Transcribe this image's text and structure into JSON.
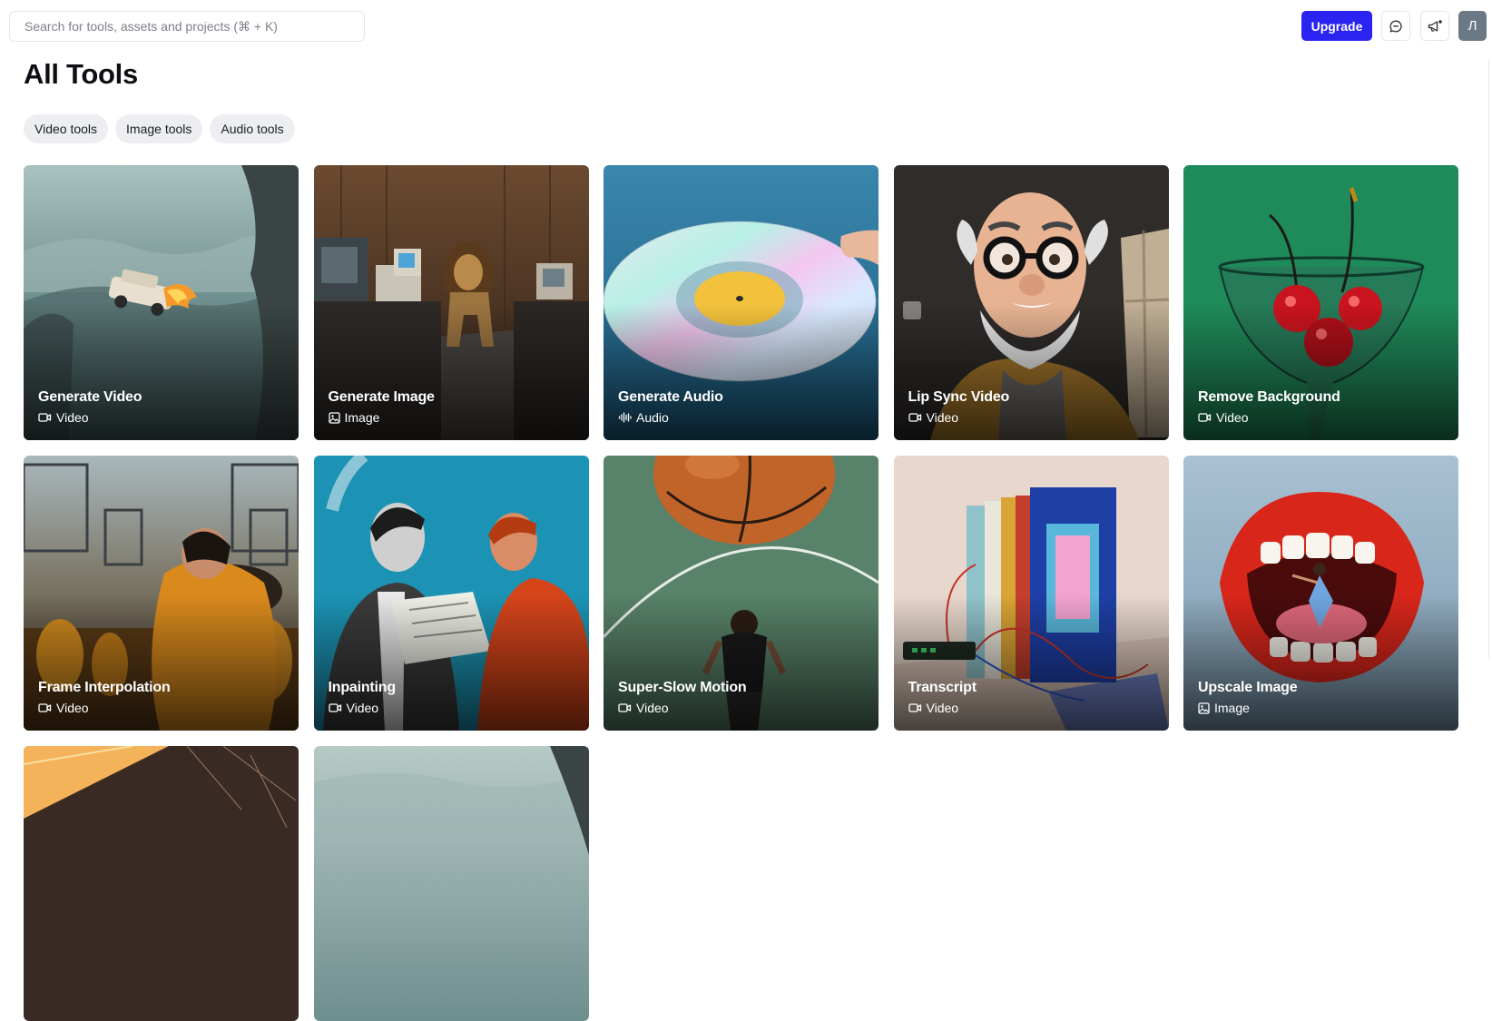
{
  "search": {
    "placeholder": "Search for tools, assets and projects (⌘ + K)"
  },
  "header": {
    "upgrade_label": "Upgrade",
    "avatar_initial": "Л"
  },
  "icons": {
    "feedback": "chat-bubble-icon",
    "announcements": "megaphone-icon"
  },
  "page": {
    "title": "All Tools"
  },
  "filters": [
    {
      "label": "Video tools"
    },
    {
      "label": "Image tools"
    },
    {
      "label": "Audio tools"
    }
  ],
  "tools": [
    {
      "name": "Generate Video",
      "type": "Video",
      "icon": "video-icon"
    },
    {
      "name": "Generate Image",
      "type": "Image",
      "icon": "image-icon"
    },
    {
      "name": "Generate Audio",
      "type": "Audio",
      "icon": "audio-wave-icon"
    },
    {
      "name": "Lip Sync Video",
      "type": "Video",
      "icon": "video-icon"
    },
    {
      "name": "Remove Background",
      "type": "Video",
      "icon": "video-icon"
    },
    {
      "name": "Frame Interpolation",
      "type": "Video",
      "icon": "video-icon"
    },
    {
      "name": "Inpainting",
      "type": "Video",
      "icon": "video-icon"
    },
    {
      "name": "Super-Slow Motion",
      "type": "Video",
      "icon": "video-icon"
    },
    {
      "name": "Transcript",
      "type": "Video",
      "icon": "video-icon"
    },
    {
      "name": "Upscale Image",
      "type": "Image",
      "icon": "image-icon"
    }
  ],
  "colors": {
    "accent": "#2b23f0",
    "avatar_bg": "#6b7885",
    "chip_bg": "#eceef1"
  }
}
